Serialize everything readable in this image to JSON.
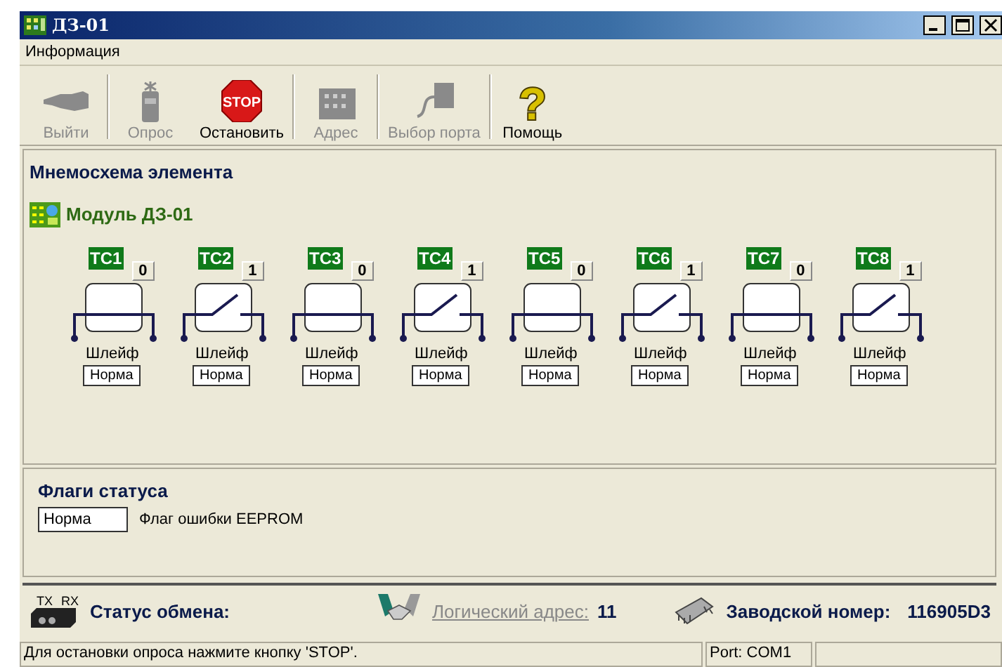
{
  "window": {
    "title": "ДЗ-01"
  },
  "menu": [
    "Информация"
  ],
  "toolbar": [
    {
      "kind": "hand",
      "label": "Выйти",
      "disabled": true
    },
    {
      "kind": "radio",
      "label": "Опрос",
      "disabled": true
    },
    {
      "kind": "stop",
      "label": "Остановить",
      "icon_text": "STOP",
      "disabled": false
    },
    {
      "kind": "building",
      "label": "Адрес",
      "disabled": true
    },
    {
      "kind": "plug",
      "label": "Выбор порта",
      "disabled": true
    },
    {
      "kind": "help",
      "label": "Помощь",
      "icon_text": "?",
      "disabled": false
    }
  ],
  "scheme": {
    "title": "Мнемосхема элемента",
    "module": "Модуль ДЗ-01",
    "channels": [
      {
        "label": "ТС1",
        "value": "0",
        "switch_closed": true,
        "caption": "Шлейф",
        "status": "Норма"
      },
      {
        "label": "ТС2",
        "value": "1",
        "switch_closed": false,
        "caption": "Шлейф",
        "status": "Норма"
      },
      {
        "label": "ТС3",
        "value": "0",
        "switch_closed": true,
        "caption": "Шлейф",
        "status": "Норма"
      },
      {
        "label": "ТС4",
        "value": "1",
        "switch_closed": false,
        "caption": "Шлейф",
        "status": "Норма"
      },
      {
        "label": "ТС5",
        "value": "0",
        "switch_closed": true,
        "caption": "Шлейф",
        "status": "Норма"
      },
      {
        "label": "ТС6",
        "value": "1",
        "switch_closed": false,
        "caption": "Шлейф",
        "status": "Норма"
      },
      {
        "label": "ТС7",
        "value": "0",
        "switch_closed": true,
        "caption": "Шлейф",
        "status": "Норма"
      },
      {
        "label": "ТС8",
        "value": "1",
        "switch_closed": false,
        "caption": "Шлейф",
        "status": "Норма"
      }
    ]
  },
  "status_flags": {
    "title": "Флаги статуса",
    "flags": [
      {
        "value": "Норма",
        "label": "Флаг ошибки EEPROM"
      }
    ]
  },
  "exchange": {
    "tx": "TX",
    "rx": "RX",
    "label": "Статус обмена:",
    "address_label": "Логический адрес:",
    "address": "11",
    "serial_label": "Заводской номер:",
    "serial": "116905D3"
  },
  "status_bar": {
    "message": "Для остановки опроса нажмите кнопку 'STOP'.",
    "port": "Port: COM1"
  }
}
